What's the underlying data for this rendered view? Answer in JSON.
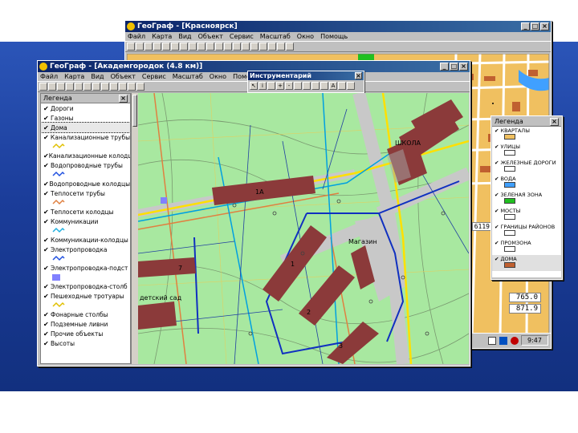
{
  "back_window": {
    "title": "ГеоГраф - [Красноярск]",
    "menu": [
      "Файл",
      "Карта",
      "Вид",
      "Объект",
      "Сервис",
      "Масштаб",
      "Окно",
      "Помощь"
    ],
    "legend": {
      "title": "Легенда",
      "items": [
        {
          "label": "КВАРТАЛЫ",
          "color": "#f0c060"
        },
        {
          "label": "УЛИЦЫ",
          "color": "#ffffff"
        },
        {
          "label": "ЖЕЛЕЗНЫЕ ДОРОГИ",
          "color": "#ffffff"
        },
        {
          "label": "ВОДА",
          "color": "#40a0ff"
        },
        {
          "label": "ЗЕЛЕНАЯ ЗОНА",
          "color": "#20c020"
        },
        {
          "label": "МОСТЫ",
          "color": "#ffffff"
        },
        {
          "label": "ГРАНИЦЫ РАЙОНОВ",
          "color": "#ffffff"
        },
        {
          "label": "ПРОМЗОНА",
          "color": "#ffffff"
        },
        {
          "label": "ДОМА",
          "color": "#c06030"
        }
      ]
    },
    "status_number": "6119",
    "readout_1": "765.0",
    "readout_2": "871.9",
    "clock": "9:47"
  },
  "front_window": {
    "title": "ГеоГраф - [Академгородок (4.8 км)]",
    "menu": [
      "Файл",
      "Карта",
      "Вид",
      "Объект",
      "Сервис",
      "Масштаб",
      "Окно",
      "Помощь"
    ],
    "tools_title": "Инструментарий",
    "legend": {
      "title": "Легенда",
      "items": [
        {
          "label": "Дороги",
          "symbol": "none"
        },
        {
          "label": "Газоны",
          "symbol": "none"
        },
        {
          "label": "Дома",
          "symbol": "none",
          "selected": true
        },
        {
          "label": "Канализационные трубы",
          "symbol": "wave-yellow"
        },
        {
          "label": "Канализационные колодцы",
          "symbol": "none"
        },
        {
          "label": "Водопроводные трубы",
          "symbol": "wave-blue"
        },
        {
          "label": "Водопроводные колодцы",
          "symbol": "none"
        },
        {
          "label": "Теплосети трубы",
          "symbol": "wave-orange"
        },
        {
          "label": "Теплосети колодцы",
          "symbol": "none"
        },
        {
          "label": "Коммуникации",
          "symbol": "wave-cyan"
        },
        {
          "label": "Коммуникации-колодцы",
          "symbol": "none"
        },
        {
          "label": "Электропроводка",
          "symbol": "wave-blue"
        },
        {
          "label": "Электропроводка-подст",
          "symbol": "square-blue"
        },
        {
          "label": "Электропроводка-столб",
          "symbol": "none"
        },
        {
          "label": "Пешеходные тротуары",
          "symbol": "wave-yellow"
        },
        {
          "label": "Фонарные столбы",
          "symbol": "none"
        },
        {
          "label": "Подземные ливни",
          "symbol": "none"
        },
        {
          "label": "Прочие объекты",
          "symbol": "none"
        },
        {
          "label": "Высоты",
          "symbol": "none"
        }
      ]
    },
    "map_labels": {
      "building_1a": "1А",
      "building_1": "1",
      "building_2": "2",
      "building_3": "3",
      "building_7": "7",
      "school": "ШКОЛА",
      "shop": "Магазин",
      "kindergarten": "детский сад"
    }
  },
  "colors": {
    "slide_blue": "#1b3d9a",
    "title_blue": "#0a246a",
    "map_green": "#a8e8a0",
    "building": "#8b3a3a",
    "road": "#c8c8c8"
  }
}
